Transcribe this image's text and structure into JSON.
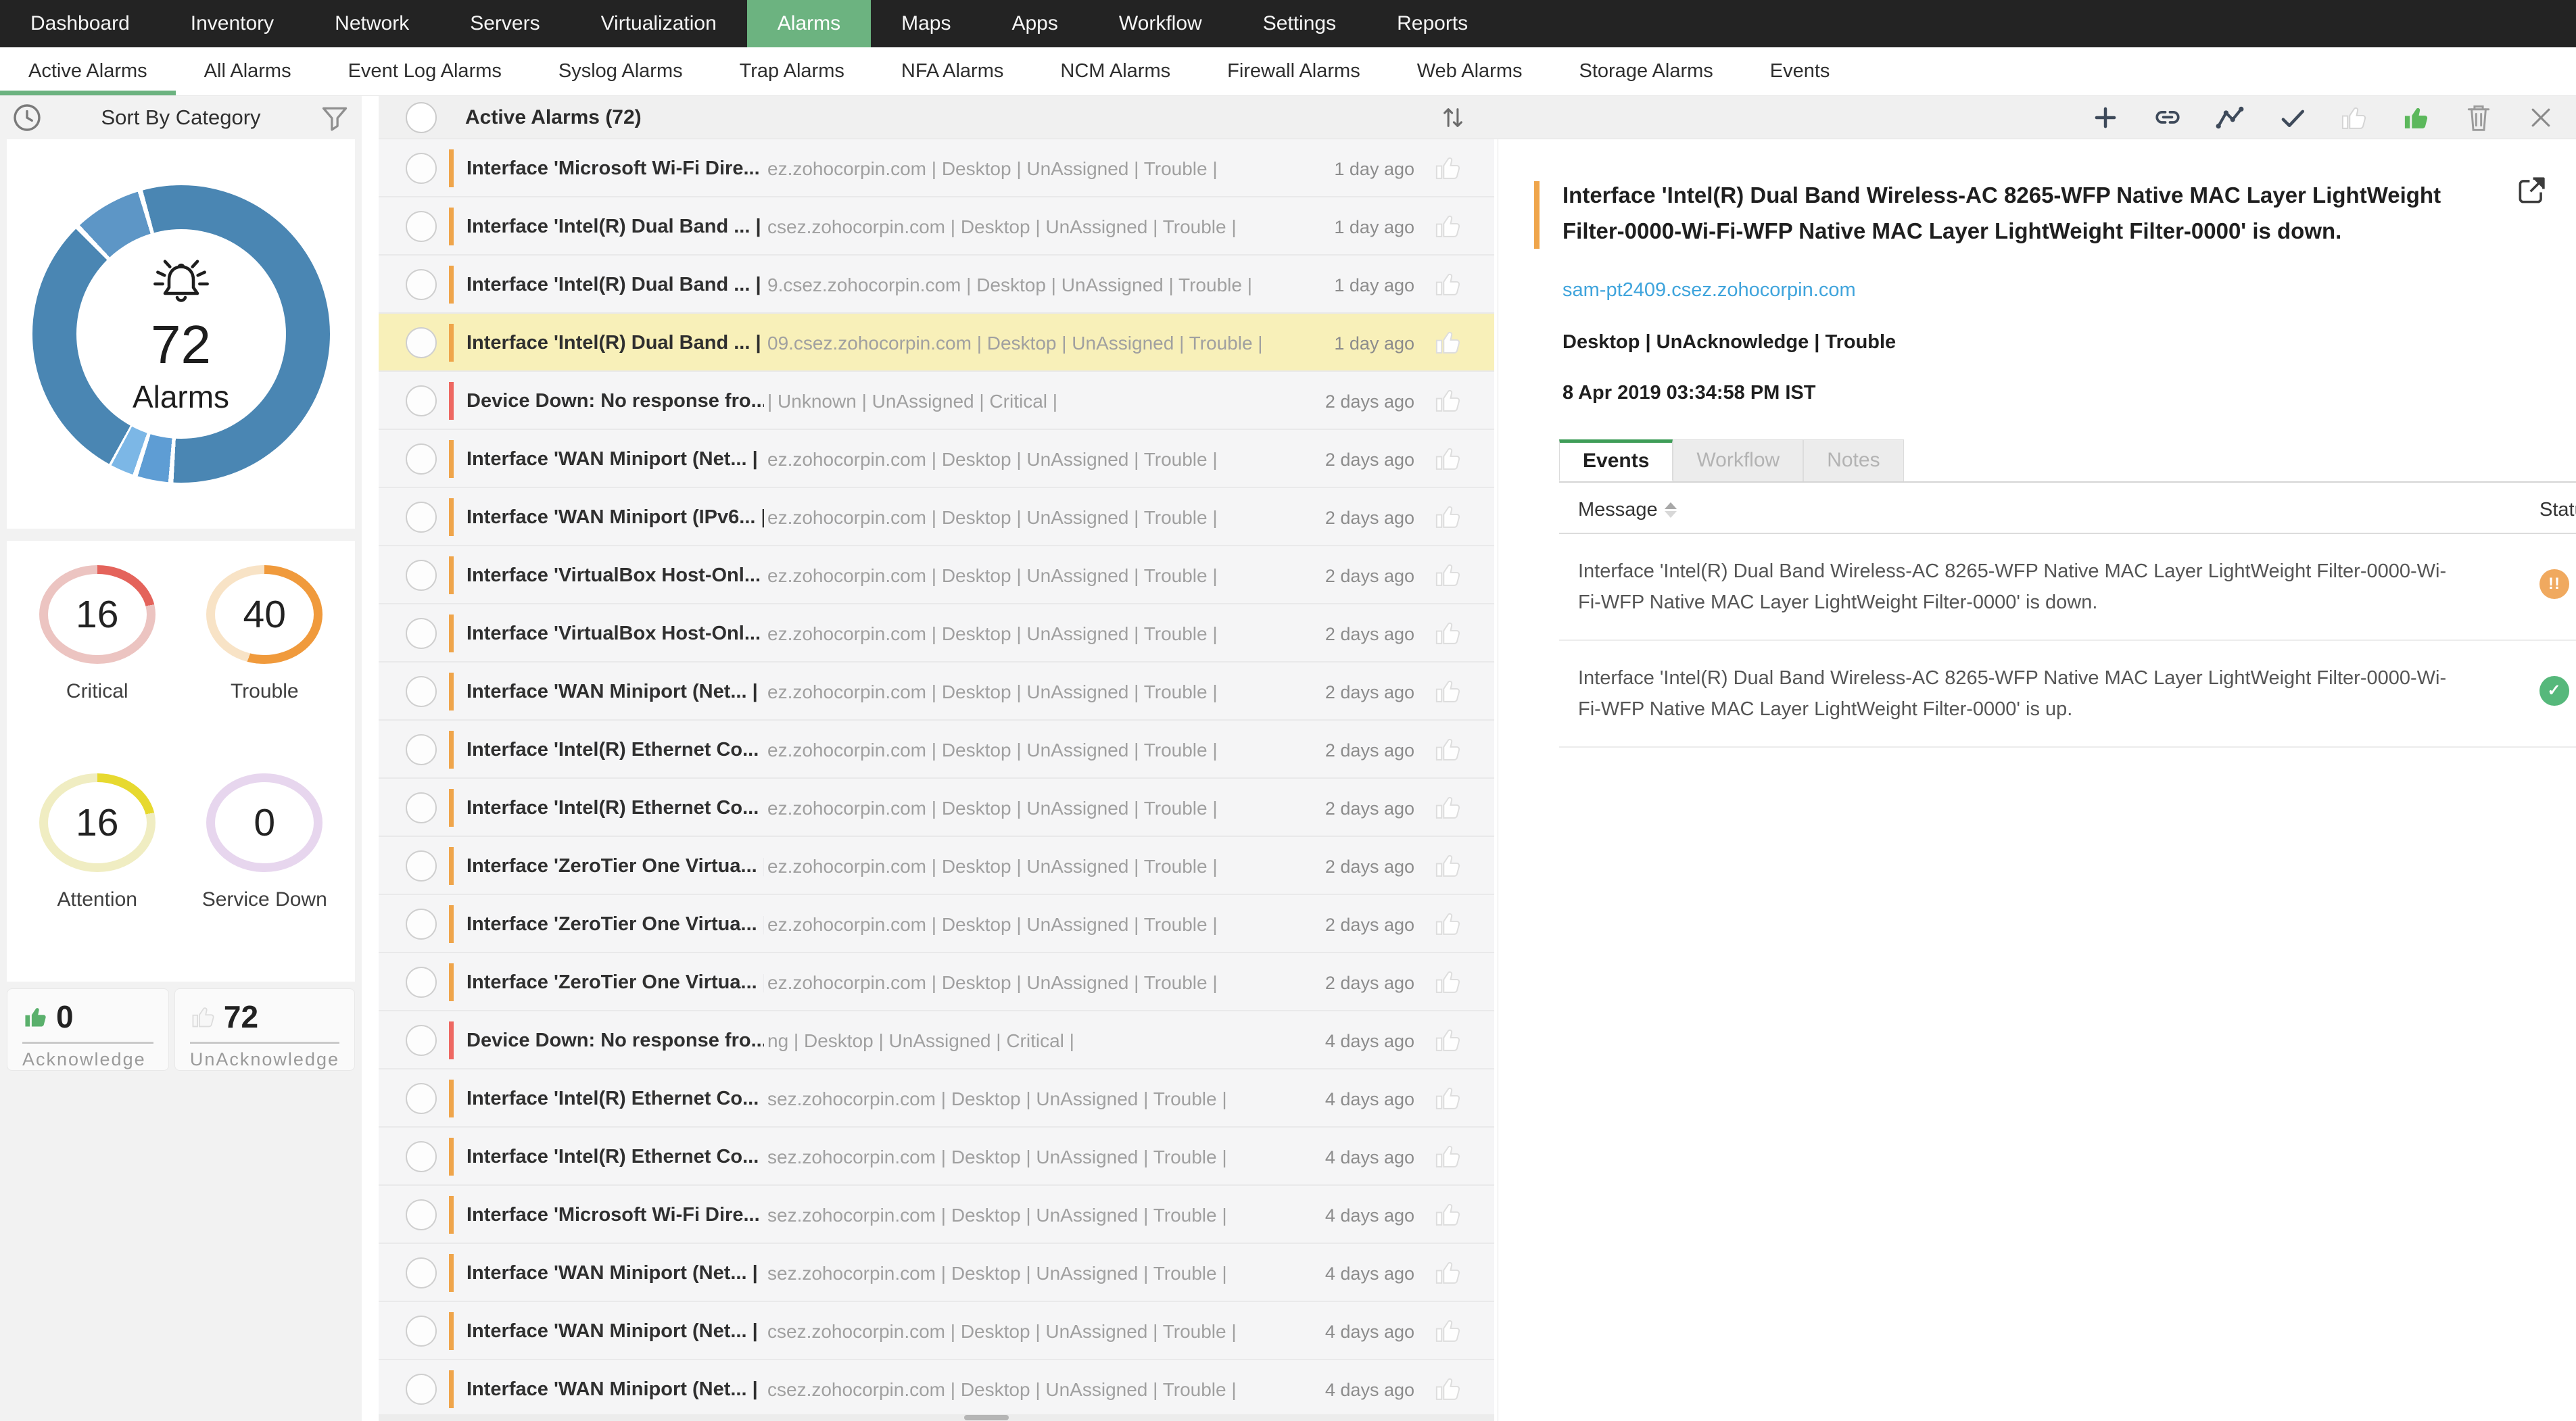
{
  "topnav": {
    "items": [
      {
        "label": "Dashboard"
      },
      {
        "label": "Inventory"
      },
      {
        "label": "Network"
      },
      {
        "label": "Servers"
      },
      {
        "label": "Virtualization"
      },
      {
        "label": "Alarms",
        "active": true
      },
      {
        "label": "Maps"
      },
      {
        "label": "Apps"
      },
      {
        "label": "Workflow"
      },
      {
        "label": "Settings"
      },
      {
        "label": "Reports"
      }
    ]
  },
  "subnav": {
    "items": [
      {
        "label": "Active Alarms",
        "active": true
      },
      {
        "label": "All Alarms"
      },
      {
        "label": "Event Log Alarms"
      },
      {
        "label": "Syslog Alarms"
      },
      {
        "label": "Trap Alarms"
      },
      {
        "label": "NFA Alarms"
      },
      {
        "label": "NCM Alarms"
      },
      {
        "label": "Firewall Alarms"
      },
      {
        "label": "Web Alarms"
      },
      {
        "label": "Storage Alarms"
      },
      {
        "label": "Events"
      }
    ]
  },
  "sidebar": {
    "header_title": "Sort By Category",
    "donut": {
      "count": "72",
      "label": "Alarms"
    },
    "rings": [
      {
        "value": "16",
        "label": "Critical",
        "kind": "critical",
        "arc_color": "#e4635b",
        "track_color": "#ecc4c1"
      },
      {
        "value": "40",
        "label": "Trouble",
        "kind": "trouble",
        "arc_color": "#f09a3c",
        "track_color": "#f8e3c6"
      },
      {
        "value": "16",
        "label": "Attention",
        "kind": "attention",
        "arc_color": "#e7d92f",
        "track_color": "#f0edc2"
      },
      {
        "value": "0",
        "label": "Service Down",
        "kind": "servicedown",
        "arc_color": "#e7d6ee",
        "track_color": "#e7d6ee"
      }
    ],
    "ack": {
      "value": "0",
      "label": "Acknowledge"
    },
    "unack": {
      "value": "72",
      "label": "UnAcknowledge"
    }
  },
  "list": {
    "title": "Active Alarms (72)",
    "rows": [
      {
        "title": "Interface 'Microsoft Wi-Fi Dire... |",
        "meta": "ez.zohocorpin.com | Desktop | UnAssigned | Trouble |",
        "time": "1 day ago",
        "severity": "trouble"
      },
      {
        "title": "Interface 'Intel(R) Dual Band ... |",
        "meta": "csez.zohocorpin.com | Desktop | UnAssigned | Trouble |",
        "time": "1 day ago",
        "severity": "trouble"
      },
      {
        "title": "Interface 'Intel(R) Dual Band ... |",
        "meta": "9.csez.zohocorpin.com | Desktop | UnAssigned | Trouble |",
        "time": "1 day ago",
        "severity": "trouble"
      },
      {
        "title": "Interface 'Intel(R) Dual Band ... |",
        "meta": "09.csez.zohocorpin.com | Desktop | UnAssigned | Trouble |",
        "time": "1 day ago",
        "severity": "trouble",
        "selected": true
      },
      {
        "title": "Device Down: No response fro... |",
        "meta": "| Unknown | UnAssigned | Critical |",
        "time": "2 days ago",
        "severity": "critical"
      },
      {
        "title": "Interface 'WAN Miniport (Net... |",
        "meta": "ez.zohocorpin.com | Desktop | UnAssigned | Trouble |",
        "time": "2 days ago",
        "severity": "trouble"
      },
      {
        "title": "Interface 'WAN Miniport (IPv6... |",
        "meta": "ez.zohocorpin.com | Desktop | UnAssigned | Trouble |",
        "time": "2 days ago",
        "severity": "trouble"
      },
      {
        "title": "Interface 'VirtualBox Host-Onl... |",
        "meta": "ez.zohocorpin.com | Desktop | UnAssigned | Trouble |",
        "time": "2 days ago",
        "severity": "trouble"
      },
      {
        "title": "Interface 'VirtualBox Host-Onl... |",
        "meta": "ez.zohocorpin.com | Desktop | UnAssigned | Trouble |",
        "time": "2 days ago",
        "severity": "trouble"
      },
      {
        "title": "Interface 'WAN Miniport (Net... |",
        "meta": "ez.zohocorpin.com | Desktop | UnAssigned | Trouble |",
        "time": "2 days ago",
        "severity": "trouble"
      },
      {
        "title": "Interface 'Intel(R) Ethernet Co... |",
        "meta": "ez.zohocorpin.com | Desktop | UnAssigned | Trouble |",
        "time": "2 days ago",
        "severity": "trouble"
      },
      {
        "title": "Interface 'Intel(R) Ethernet Co... |",
        "meta": "ez.zohocorpin.com | Desktop | UnAssigned | Trouble |",
        "time": "2 days ago",
        "severity": "trouble"
      },
      {
        "title": "Interface 'ZeroTier One Virtua... |",
        "meta": "ez.zohocorpin.com | Desktop | UnAssigned | Trouble |",
        "time": "2 days ago",
        "severity": "trouble"
      },
      {
        "title": "Interface 'ZeroTier One Virtua... |",
        "meta": "ez.zohocorpin.com | Desktop | UnAssigned | Trouble |",
        "time": "2 days ago",
        "severity": "trouble"
      },
      {
        "title": "Interface 'ZeroTier One Virtua... |",
        "meta": "ez.zohocorpin.com | Desktop | UnAssigned | Trouble |",
        "time": "2 days ago",
        "severity": "trouble"
      },
      {
        "title": "Device Down: No response fro... |",
        "meta": "ng | Desktop | UnAssigned | Critical |",
        "time": "4 days ago",
        "severity": "critical"
      },
      {
        "title": "Interface 'Intel(R) Ethernet Co... |",
        "meta": "sez.zohocorpin.com | Desktop | UnAssigned | Trouble |",
        "time": "4 days ago",
        "severity": "trouble"
      },
      {
        "title": "Interface 'Intel(R) Ethernet Co... |",
        "meta": "sez.zohocorpin.com | Desktop | UnAssigned | Trouble |",
        "time": "4 days ago",
        "severity": "trouble"
      },
      {
        "title": "Interface 'Microsoft Wi-Fi Dire... |",
        "meta": "sez.zohocorpin.com | Desktop | UnAssigned | Trouble |",
        "time": "4 days ago",
        "severity": "trouble"
      },
      {
        "title": "Interface 'WAN Miniport (Net... |",
        "meta": "sez.zohocorpin.com | Desktop | UnAssigned | Trouble |",
        "time": "4 days ago",
        "severity": "trouble"
      },
      {
        "title": "Interface 'WAN Miniport (Net... |",
        "meta": "csez.zohocorpin.com | Desktop | UnAssigned | Trouble |",
        "time": "4 days ago",
        "severity": "trouble"
      },
      {
        "title": "Interface 'WAN Miniport (Net... |",
        "meta": "csez.zohocorpin.com | Desktop | UnAssigned | Trouble |",
        "time": "4 days ago",
        "severity": "trouble"
      }
    ]
  },
  "detail": {
    "title": "Interface 'Intel(R) Dual Band Wireless-AC 8265-WFP Native MAC Layer LightWeight Filter-0000-Wi-Fi-WFP Native MAC Layer LightWeight Filter-0000' is down.",
    "host_link": "sam-pt2409.csez.zohocorpin.com",
    "meta": "Desktop | UnAcknowledge | Trouble",
    "timestamp": "8 Apr 2019 03:34:58 PM IST",
    "tabs": [
      {
        "label": "Events",
        "active": true
      },
      {
        "label": "Workflow"
      },
      {
        "label": "Notes"
      }
    ],
    "table": {
      "col_message": "Message",
      "col_status": "Status",
      "rows": [
        {
          "message": "Interface 'Intel(R) Dual Band Wireless-AC 8265-WFP Native MAC Layer LightWeight Filter-0000-Wi-Fi-WFP Native MAC Layer LightWeight Filter-0000' is down.",
          "status": "Trouble",
          "kind": "trouble"
        },
        {
          "message": "Interface 'Intel(R) Dual Band Wireless-AC 8265-WFP Native MAC Layer LightWeight Filter-0000-Wi-Fi-WFP Native MAC Layer LightWeight Filter-0000' is up.",
          "status": "Clear",
          "kind": "clear"
        }
      ]
    }
  },
  "colors": {
    "nav_dark": "#232323",
    "accent_green": "#6cb380",
    "tab_green": "#3f9d58",
    "donut_blue": "#4a86b3",
    "donut_blue_light": "#5d96c6",
    "donut_blue_lighter": "#7cb7e6",
    "critical_bar": "#ee6862",
    "trouble_bar": "#efa54b",
    "selected_row": "#f8f0b9",
    "link_blue": "#3fa4dc",
    "status_trouble": "#f0a95f",
    "status_clear": "#56b87b",
    "ack_thumb_green": "#5ab06c"
  }
}
